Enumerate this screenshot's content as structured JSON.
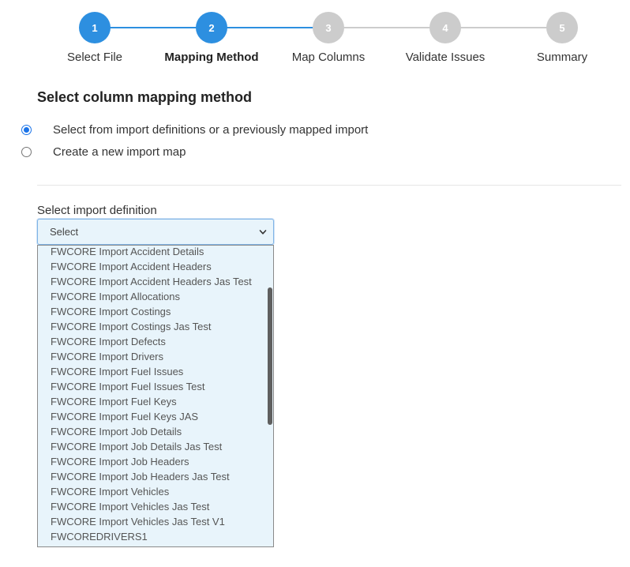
{
  "stepper": {
    "steps": [
      {
        "number": "1",
        "label": "Select File"
      },
      {
        "number": "2",
        "label": "Mapping Method"
      },
      {
        "number": "3",
        "label": "Map Columns"
      },
      {
        "number": "4",
        "label": "Validate Issues"
      },
      {
        "number": "5",
        "label": "Summary"
      }
    ],
    "current_step": 2,
    "colors": {
      "active": "#2d8fe0",
      "inactive": "#cccccc"
    }
  },
  "section": {
    "title": "Select column mapping method",
    "options": [
      {
        "label": "Select from import definitions or a previously mapped import",
        "checked": true
      },
      {
        "label": "Create a new import map",
        "checked": false
      }
    ]
  },
  "definition": {
    "label": "Select import definition",
    "selected": "Select",
    "options": [
      "FWCORE Import Accident Details",
      "FWCORE Import Accident Headers",
      "FWCORE Import Accident Headers Jas Test",
      "FWCORE Import Allocations",
      "FWCORE Import Costings",
      "FWCORE Import Costings Jas Test",
      "FWCORE Import Defects",
      "FWCORE Import Drivers",
      "FWCORE Import Fuel Issues",
      "FWCORE Import Fuel Issues Test",
      "FWCORE Import Fuel Keys",
      "FWCORE Import Fuel Keys JAS",
      "FWCORE Import Job Details",
      "FWCORE Import Job Details Jas Test",
      "FWCORE Import Job Headers",
      "FWCORE Import Job Headers Jas Test",
      "FWCORE Import Vehicles",
      "FWCORE Import Vehicles Jas Test",
      "FWCORE Import Vehicles Jas Test V1",
      "FWCOREDRIVERS1"
    ]
  }
}
